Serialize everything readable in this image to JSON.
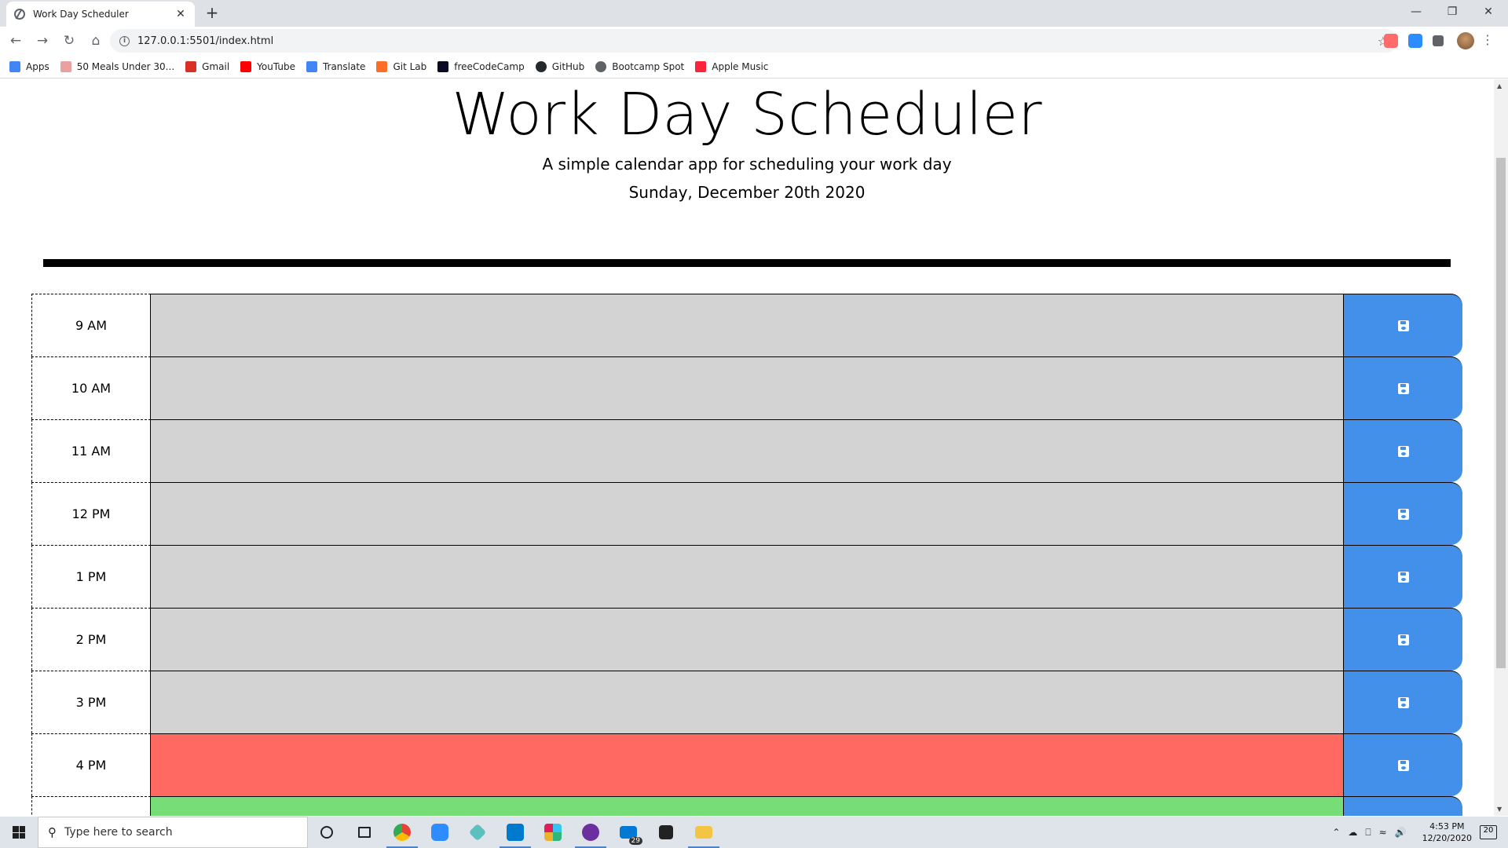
{
  "browser": {
    "tab_title": "Work Day Scheduler",
    "new_tab_symbol": "+",
    "close_symbol": "✕",
    "url": "127.0.0.1:5501/index.html",
    "bookmarks": [
      {
        "label": "Apps",
        "color": "#4285f4"
      },
      {
        "label": "50 Meals Under 30...",
        "color": "#e8a0a0"
      },
      {
        "label": "Gmail",
        "color": "#d93025"
      },
      {
        "label": "YouTube",
        "color": "#ff0000"
      },
      {
        "label": "Translate",
        "color": "#4285f4"
      },
      {
        "label": "Git Lab",
        "color": "#fc6d26"
      },
      {
        "label": "freeCodeCamp",
        "color": "#0a0a23"
      },
      {
        "label": "GitHub",
        "color": "#24292e"
      },
      {
        "label": "Bootcamp Spot",
        "color": "#5f6368"
      },
      {
        "label": "Apple Music",
        "color": "#fa243c"
      }
    ]
  },
  "header": {
    "title": "Work Day Scheduler",
    "lead": "A simple calendar app for scheduling your work day",
    "current_day": "Sunday, December 20th 2020"
  },
  "timeblocks": [
    {
      "hour": "9 AM",
      "state": "past",
      "text": ""
    },
    {
      "hour": "10 AM",
      "state": "past",
      "text": ""
    },
    {
      "hour": "11 AM",
      "state": "past",
      "text": ""
    },
    {
      "hour": "12 PM",
      "state": "past",
      "text": ""
    },
    {
      "hour": "1 PM",
      "state": "past",
      "text": ""
    },
    {
      "hour": "2 PM",
      "state": "past",
      "text": ""
    },
    {
      "hour": "3 PM",
      "state": "past",
      "text": ""
    },
    {
      "hour": "4 PM",
      "state": "present",
      "text": ""
    },
    {
      "hour": "",
      "state": "future",
      "text": ""
    }
  ],
  "colors": {
    "past": "#d3d3d3",
    "present": "#ff6961",
    "future": "#77dd77",
    "save_button": "#4390ea"
  },
  "taskbar": {
    "search_placeholder": "Type here to search",
    "mail_badge": "29",
    "time": "4:53 PM",
    "date": "12/20/2020",
    "notification_count": "20"
  }
}
